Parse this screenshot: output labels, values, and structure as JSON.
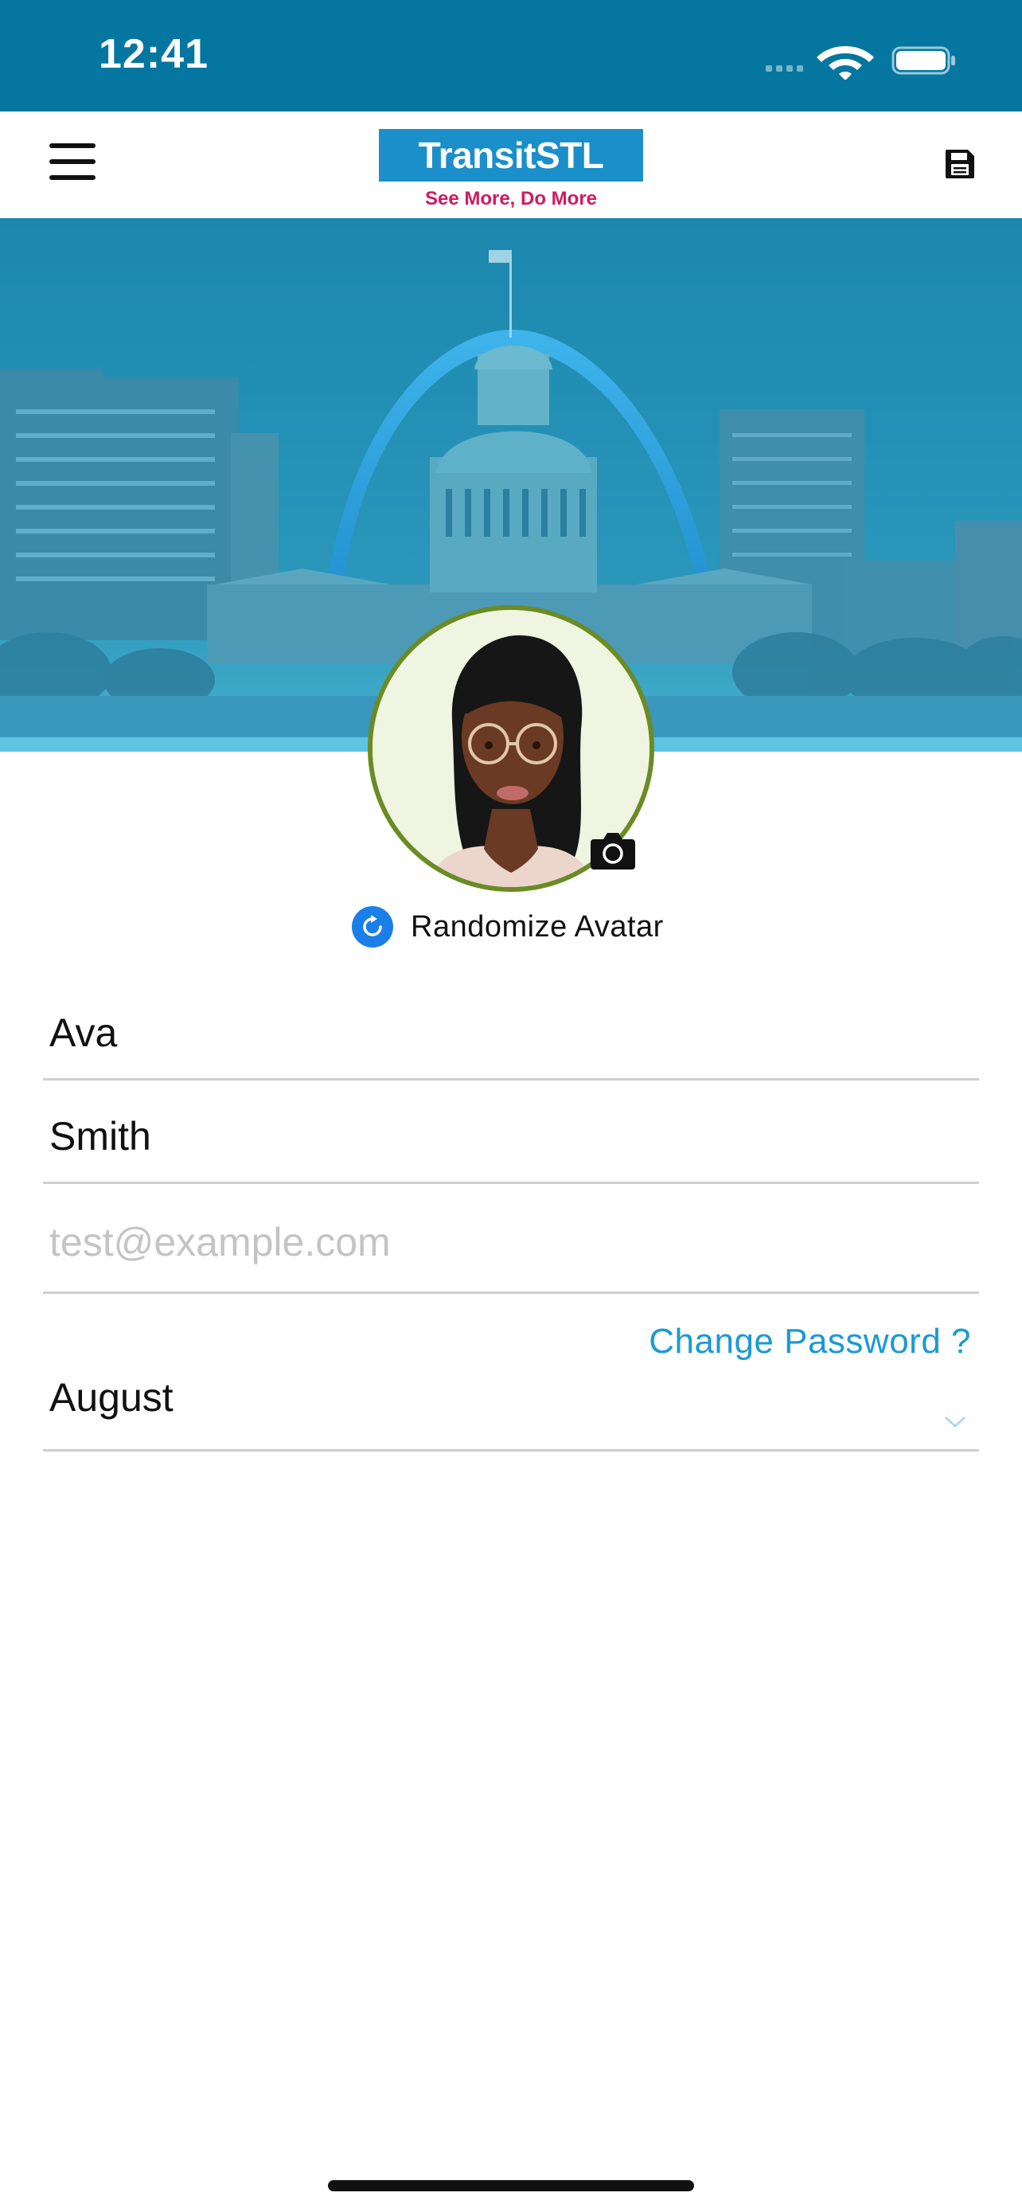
{
  "status_bar": {
    "time": "12:41",
    "icons": [
      "signal-icon",
      "wifi-icon",
      "battery-icon"
    ]
  },
  "header": {
    "menu_icon": "hamburger-menu-icon",
    "logo_text": "TransitSTL",
    "logo_tagline": "See More, Do More",
    "save_icon": "floppy-disk-icon"
  },
  "profile": {
    "randomize_label": "Randomize Avatar",
    "randomize_icon": "refresh-icon",
    "camera_icon": "camera-icon"
  },
  "form": {
    "first_name": "Ava",
    "last_name": "Smith",
    "email_value": "",
    "email_placeholder": "test@example.com",
    "change_password_label": "Change Password ?",
    "birth_month": "August"
  },
  "colors": {
    "status_bar": "#05769f",
    "logo_bg": "#1a8fc9",
    "tagline": "#d11a5f",
    "link": "#1a9ad2",
    "avatar_ring": "#6b8b24",
    "randomize_icon_bg": "#1a7fe8"
  }
}
